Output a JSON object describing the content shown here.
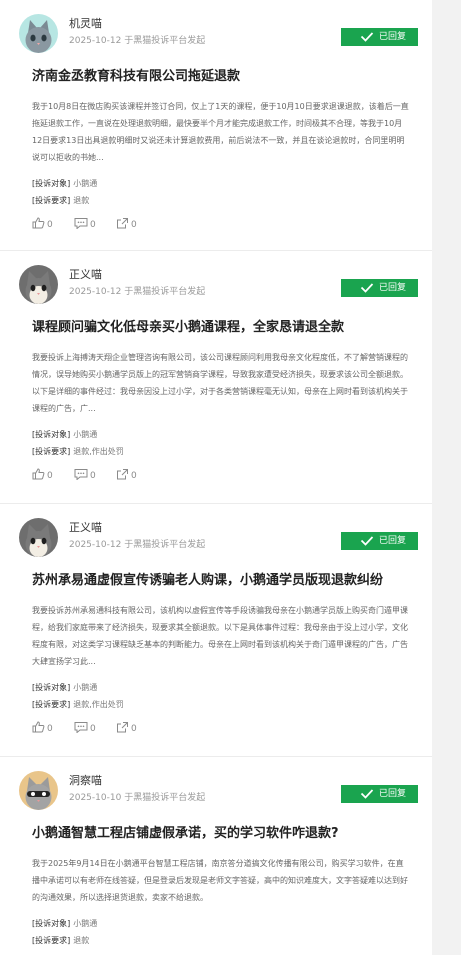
{
  "complaints": [
    {
      "avatar": "gray-cat-avatar",
      "user": "机灵喵",
      "date": "2025-10-12",
      "platform": "于黑猫投诉平台发起",
      "status": "已回复",
      "title": "济南金丞教育科技有限公司拖延退款",
      "desc": "我于10月8日在微店购买该课程并签订合同，仅上了1天的课程，便于10月10日要求退课退款，该着后一直拖延退款工作，一直说在处理退款明细，最快要半个月才能完成退款工作，时间极其不合理，等我于10月12日要求13日出具退款明细时又说还未计算退款费用，前后说法不一致，并且在谈论退款时，合同里明明说可以拒收的书她...",
      "target_label": "[投诉对象]",
      "target": "小鹅通",
      "request_label": "[投诉要求]",
      "request": "退款",
      "likes": "0",
      "comments": "0",
      "shares": "0"
    },
    {
      "avatar": "gray-white-cat-avatar",
      "user": "正义喵",
      "date": "2025-10-12",
      "platform": "于黑猫投诉平台发起",
      "status": "已回复",
      "title": "课程顾问骗文化低母亲买小鹅通课程，全家恳请退全款",
      "desc": "我要投诉上海搏涛天翔企业管理咨询有限公司，该公司课程顾问利用我母亲文化程度低，不了解营销课程的情况，误导她购买小鹅通学员版上的冠军营销商学课程，导致我家遭受经济损失，现要求该公司全额退款。以下是详细的事件经过：我母亲因没上过小学，对于各类营销课程毫无认知，母亲在上网时看到该机构关于课程的广告，广...",
      "target_label": "[投诉对象]",
      "target": "小鹅通",
      "request_label": "[投诉要求]",
      "request": "退款,作出处罚",
      "likes": "0",
      "comments": "0",
      "shares": "0"
    },
    {
      "avatar": "gray-white-cat-avatar",
      "user": "正义喵",
      "date": "2025-10-12",
      "platform": "于黑猫投诉平台发起",
      "status": "已回复",
      "title": "苏州承易通虚假宣传诱骗老人购课，小鹅通学员版现退款纠纷",
      "desc": "我要投诉苏州承易通科技有限公司，该机构以虚假宣传等手段诱骗我母亲在小鹅通学员版上购买奇门遁甲课程，给我们家庭带来了经济损失，现要求其全额退款。以下是具体事件过程：我母亲由于没上过小学，文化程度有限，对这类学习课程缺乏基本的判断能力。母亲在上网时看到该机构关于奇门遁甲课程的广告，广告大肆宣扬学习此...",
      "target_label": "[投诉对象]",
      "target": "小鹅通",
      "request_label": "[投诉要求]",
      "request": "退款,作出处罚",
      "likes": "0",
      "comments": "0",
      "shares": "0"
    },
    {
      "avatar": "orange-cat-avatar",
      "user": "洞察喵",
      "date": "2025-10-10",
      "platform": "于黑猫投诉平台发起",
      "status": "已回复",
      "title": "小鹅通智慧工程店铺虚假承诺，买的学习软件咋退款?",
      "desc": "我于2025年9月14日在小鹅通平台智慧工程店铺，南京答分道搞文化传播有限公司，购买学习软件，在直播中承诺可以有老师在线答疑，但是登录后发现是老师文字答疑，高中的知识难度大，文字答疑难以达到好的沟通效果，所以选择退货退款，卖家不给退款。",
      "target_label": "[投诉对象]",
      "target": "小鹅通",
      "request_label": "[投诉要求]",
      "request": "退款",
      "likes": "0",
      "comments": "0",
      "shares": "0"
    }
  ]
}
